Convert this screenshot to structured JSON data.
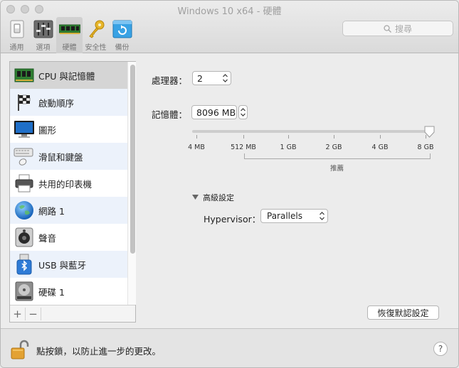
{
  "window": {
    "title": "Windows 10 x64 - 硬體"
  },
  "toolbar": {
    "items": [
      {
        "label": "通用",
        "icon": "general-switch-icon"
      },
      {
        "label": "選項",
        "icon": "options-sliders-icon"
      },
      {
        "label": "硬體",
        "icon": "hardware-ram-icon",
        "selected": true
      },
      {
        "label": "安全性",
        "icon": "security-key-icon"
      },
      {
        "label": "備份",
        "icon": "backup-icon"
      }
    ]
  },
  "search": {
    "placeholder": "搜尋"
  },
  "sidebar": {
    "items": [
      {
        "label": "CPU 與記憶體",
        "icon": "cpu-memory-icon",
        "selected": true
      },
      {
        "label": "啟動順序",
        "icon": "boot-order-flag-icon"
      },
      {
        "label": "圖形",
        "icon": "display-monitor-icon"
      },
      {
        "label": "滑鼠和鍵盤",
        "icon": "keyboard-mouse-icon"
      },
      {
        "label": "共用的印表機",
        "icon": "printer-icon"
      },
      {
        "label": "網路 1",
        "icon": "network-globe-icon"
      },
      {
        "label": "聲音",
        "icon": "speaker-icon"
      },
      {
        "label": "USB 與藍牙",
        "icon": "usb-bluetooth-icon"
      },
      {
        "label": "硬碟 1",
        "icon": "hard-disk-icon"
      }
    ],
    "add_label": "+",
    "remove_label": "−"
  },
  "cpu": {
    "label": "處理器：",
    "value": "2"
  },
  "memory": {
    "label": "記憶體：",
    "value": "8096 MB",
    "slider_ticks": [
      "4 MB",
      "512 MB",
      "1 GB",
      "2 GB",
      "4 GB",
      "8 GB"
    ],
    "slider_level_tick_index": 5,
    "recommended_label": "推薦"
  },
  "advanced": {
    "label": "高級設定",
    "hypervisor_label": "Hypervisor：",
    "hypervisor_value": "Parallels"
  },
  "restore_button": {
    "label": "恢復默認設定"
  },
  "footer": {
    "lock_text": "點按鎖，以防止進一步的更改。",
    "help_label": "?"
  },
  "colors": {
    "accent_blue": "#2e7bd6",
    "selected_row": "#d5d5d5",
    "alt_row": "#ecf2fb"
  }
}
